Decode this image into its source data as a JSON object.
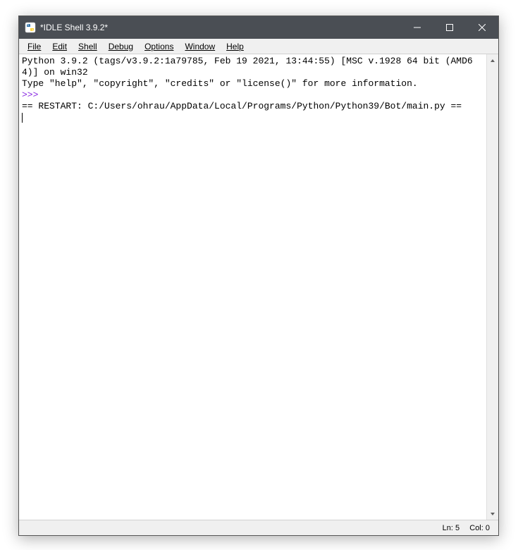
{
  "window": {
    "title": "*IDLE Shell 3.9.2*"
  },
  "menubar": {
    "file": "File",
    "edit": "Edit",
    "shell": "Shell",
    "debug": "Debug",
    "options": "Options",
    "window": "Window",
    "help": "Help"
  },
  "shell": {
    "line1": "Python 3.9.2 (tags/v3.9.2:1a79785, Feb 19 2021, 13:44:55) [MSC v.1928 64 bit (AMD64)] on win32",
    "line2": "Type \"help\", \"copyright\", \"credits\" or \"license()\" for more information.",
    "prompt": ">>> ",
    "restart": "== RESTART: C:/Users/ohrau/AppData/Local/Programs/Python/Python39/Bot/main.py =="
  },
  "statusbar": {
    "line_label": "Ln:",
    "line_value": "5",
    "col_label": "Col:",
    "col_value": "0"
  }
}
